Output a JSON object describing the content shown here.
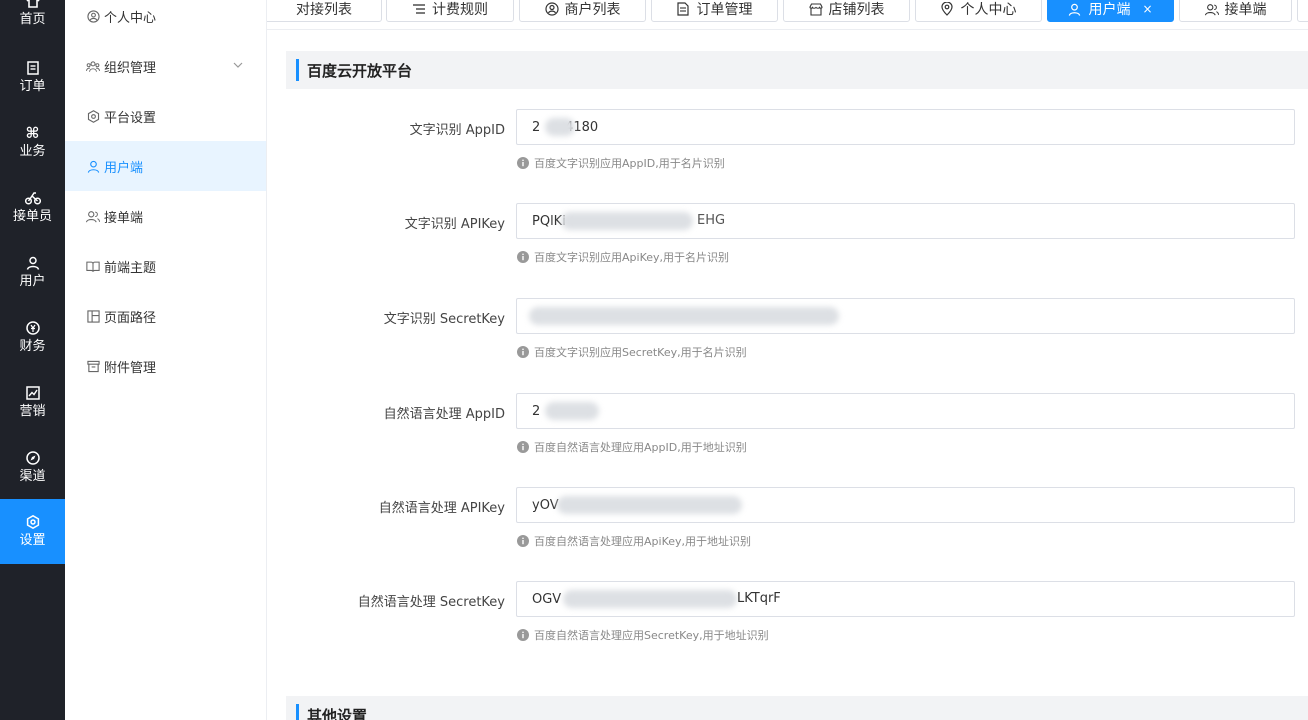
{
  "rail": [
    {
      "label": "首页",
      "icon": "home-icon"
    },
    {
      "label": "订单",
      "icon": "order-icon"
    },
    {
      "label": "业务",
      "icon": "command-icon"
    },
    {
      "label": "接单员",
      "icon": "bike-icon"
    },
    {
      "label": "用户",
      "icon": "user-icon"
    },
    {
      "label": "财务",
      "icon": "finance-icon"
    },
    {
      "label": "营销",
      "icon": "chart-icon"
    },
    {
      "label": "渠道",
      "icon": "compass-icon"
    },
    {
      "label": "设置",
      "icon": "settings-icon"
    }
  ],
  "submenu": [
    {
      "label": "个人中心",
      "icon": "user-circle-icon"
    },
    {
      "label": "组织管理",
      "icon": "team-icon"
    },
    {
      "label": "平台设置",
      "icon": "setting-hex-icon"
    },
    {
      "label": "用户端",
      "icon": "user-icon"
    },
    {
      "label": "接单端",
      "icon": "user-group-icon"
    },
    {
      "label": "前端主题",
      "icon": "book-icon"
    },
    {
      "label": "页面路径",
      "icon": "layout-icon"
    },
    {
      "label": "附件管理",
      "icon": "archive-icon"
    }
  ],
  "tabs": [
    {
      "label": "对接列表"
    },
    {
      "label": "计费规则"
    },
    {
      "label": "商户列表"
    },
    {
      "label": "订单管理"
    },
    {
      "label": "店铺列表"
    },
    {
      "label": "个人中心"
    },
    {
      "label": "用户端"
    },
    {
      "label": "接单端"
    }
  ],
  "close_glyph": "×",
  "sections": {
    "baidu": "百度云开放平台",
    "other": "其他设置"
  },
  "fields": [
    {
      "label": "文字识别 AppID",
      "value": "2      4180",
      "help": "百度文字识别应用AppID,用于名片识别"
    },
    {
      "label": "文字识别 APIKey",
      "value": "PQlKi",
      "help": "百度文字识别应用ApiKey,用于名片识别"
    },
    {
      "label": "文字识别 SecretKey",
      "value": "",
      "help": "百度文字识别应用SecretKey,用于名片识别"
    },
    {
      "label": "自然语言处理 AppID",
      "value": "2",
      "help": "百度自然语言处理应用AppID,用于地址识别"
    },
    {
      "label": "自然语言处理 APIKey",
      "value": "yOV",
      "help": "百度自然语言处理应用ApiKey,用于地址识别"
    },
    {
      "label": "自然语言处理 SecretKey",
      "value": "OGV",
      "help": "百度自然语言处理应用SecretKey,用于地址识别"
    }
  ],
  "field_suffix": {
    "f0": "",
    "f1": "EHG",
    "f5": "LKTqrF"
  },
  "colors": {
    "primary": "#1890ff",
    "rail_bg": "#1f2229",
    "active_menu_bg": "#e8f4ff"
  }
}
